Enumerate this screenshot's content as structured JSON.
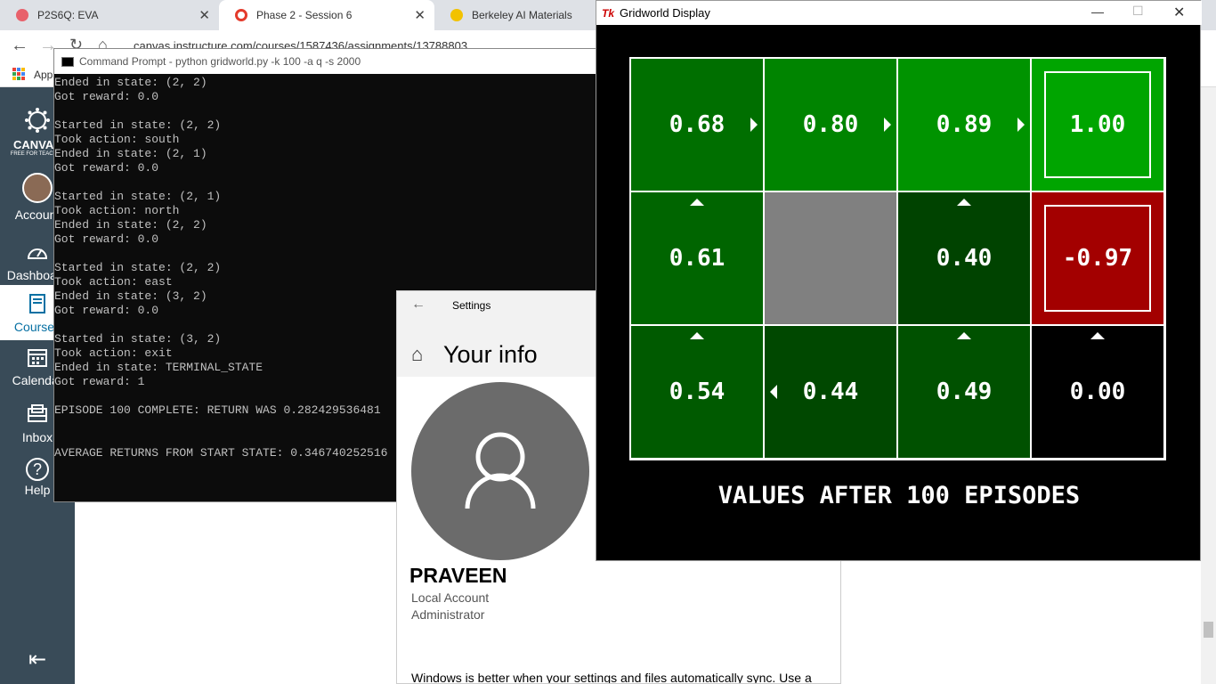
{
  "browser": {
    "tabs": [
      {
        "title": "P2S6Q: EVA",
        "icon_color": "#e8616b"
      },
      {
        "title": "Phase 2 - Session 6",
        "icon_color": "#e43b2c"
      },
      {
        "title": "Berkeley AI Materials",
        "icon_color": "#f2c200"
      }
    ],
    "close_glyph": "✕",
    "url": "canvas.instructure.com/courses/1587436/assignments/13788803",
    "apps_label": "Apps"
  },
  "canvas_sidebar": {
    "logo_text": "CANVAS",
    "logo_sub": "FREE FOR TEACHER",
    "items": [
      {
        "label": "Account",
        "icon": "avatar-icon"
      },
      {
        "label": "Dashboard",
        "icon": "dashboard-icon"
      },
      {
        "label": "Courses",
        "icon": "book-icon"
      },
      {
        "label": "Calendar",
        "icon": "calendar-icon"
      },
      {
        "label": "Inbox",
        "icon": "inbox-icon"
      },
      {
        "label": "Help",
        "icon": "help-icon"
      }
    ],
    "help_glyph": "?",
    "collapse_glyph": "⇤"
  },
  "cmd": {
    "title": "Command Prompt - python  gridworld.py -k 100 -a q -s 2000",
    "output": "Ended in state: (2, 2)\nGot reward: 0.0\n\nStarted in state: (2, 2)\nTook action: south\nEnded in state: (2, 1)\nGot reward: 0.0\n\nStarted in state: (2, 1)\nTook action: north\nEnded in state: (2, 2)\nGot reward: 0.0\n\nStarted in state: (2, 2)\nTook action: east\nEnded in state: (3, 2)\nGot reward: 0.0\n\nStarted in state: (3, 2)\nTook action: exit\nEnded in state: TERMINAL_STATE\nGot reward: 1\n\nEPISODE 100 COMPLETE: RETURN WAS 0.282429536481\n\n\nAVERAGE RETURNS FROM START STATE: 0.346740252516"
  },
  "settings": {
    "app_title": "Settings",
    "back_glyph": "←",
    "home_glyph": "⌂",
    "page_title": "Your info",
    "user_name": "PRAVEEN",
    "account_type": "Local Account",
    "role": "Administrator",
    "sync_text": "Windows is better when your settings and files automatically sync. Use a"
  },
  "gridworld": {
    "window_title": "Gridworld Display",
    "tk_logo": "Tk",
    "controls": {
      "minimize": "—",
      "maximize": "☐",
      "close": "✕"
    },
    "caption": "VALUES AFTER 100 EPISODES",
    "cells": [
      {
        "value": "0.68",
        "bg": "#006f00",
        "arrow": "right",
        "terminal": false
      },
      {
        "value": "0.80",
        "bg": "#008400",
        "arrow": "right",
        "terminal": false
      },
      {
        "value": "0.89",
        "bg": "#009300",
        "arrow": "right",
        "terminal": false
      },
      {
        "value": "1.00",
        "bg": "#00a500",
        "arrow": "",
        "terminal": true
      },
      {
        "value": "0.61",
        "bg": "#006500",
        "arrow": "up",
        "terminal": false
      },
      {
        "value": "",
        "bg": "#808080",
        "arrow": "",
        "terminal": false
      },
      {
        "value": "0.40",
        "bg": "#004300",
        "arrow": "up",
        "terminal": false
      },
      {
        "value": "-0.97",
        "bg": "#a30000",
        "arrow": "",
        "terminal": true
      },
      {
        "value": "0.54",
        "bg": "#005a00",
        "arrow": "up",
        "terminal": false
      },
      {
        "value": "0.44",
        "bg": "#004800",
        "arrow": "left",
        "terminal": false
      },
      {
        "value": "0.49",
        "bg": "#005100",
        "arrow": "up",
        "terminal": false
      },
      {
        "value": "0.00",
        "bg": "#000000",
        "arrow": "up",
        "terminal": false
      }
    ]
  }
}
